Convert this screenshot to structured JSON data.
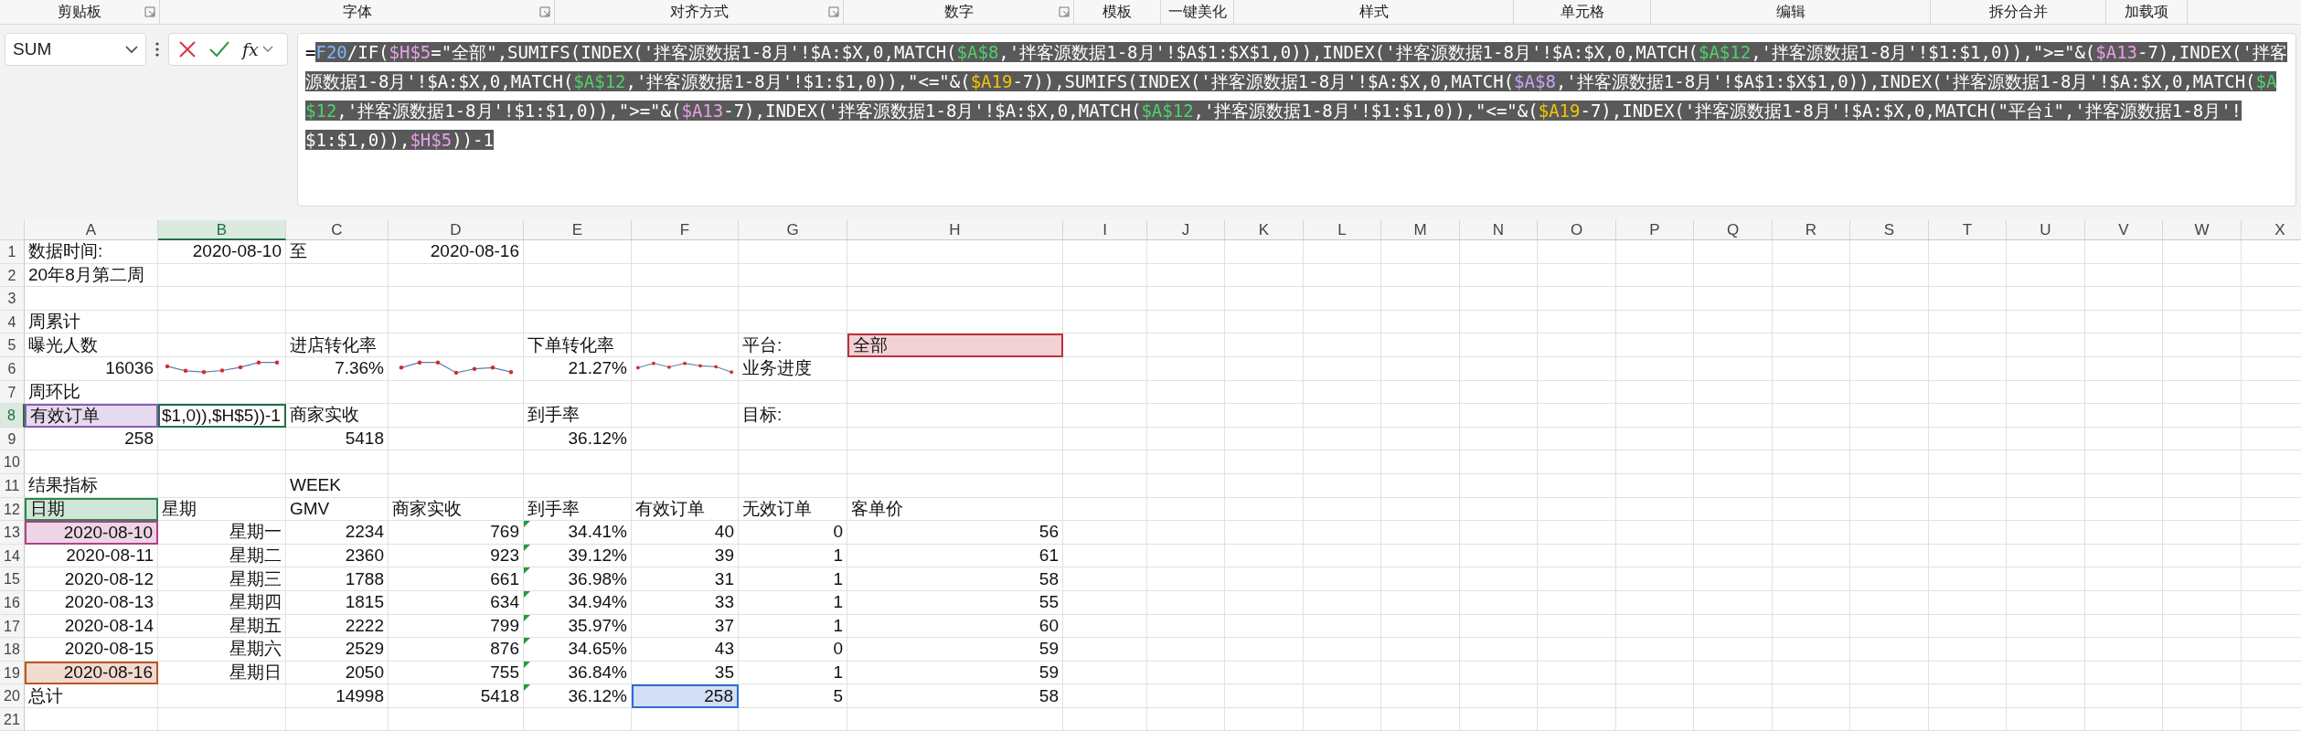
{
  "ribbon": {
    "groups": [
      {
        "label": "剪贴板",
        "launcher": true
      },
      {
        "label": "字体",
        "launcher": true
      },
      {
        "label": "对齐方式",
        "launcher": true
      },
      {
        "label": "数字",
        "launcher": true
      },
      {
        "label": "模板",
        "launcher": false
      },
      {
        "label": "一键美化",
        "launcher": false
      },
      {
        "label": "样式",
        "launcher": false
      },
      {
        "label": "单元格",
        "launcher": false
      },
      {
        "label": "编辑",
        "launcher": false
      },
      {
        "label": "拆分合并",
        "launcher": false
      },
      {
        "label": "加载项",
        "launcher": false
      }
    ]
  },
  "formula_bar": {
    "name_box": "SUM",
    "fx_label": "fx",
    "formula": [
      {
        "text": "=",
        "kind": "text",
        "selected": false
      },
      {
        "text": "F20",
        "kind": "reference",
        "selected": true
      },
      {
        "text": "/IF(",
        "kind": "text",
        "selected": true
      },
      {
        "text": "$H$5",
        "kind": "reference",
        "selected": true
      },
      {
        "text": "=\"全部\",SUMIFS(INDEX('拌客源数据1-8月'!$A:$X,0,MATCH(",
        "kind": "text",
        "selected": true
      },
      {
        "text": "$A$8",
        "kind": "reference",
        "selected": true
      },
      {
        "text": ",'拌客源数据1-8月'!$A$1:$X$1,0)),INDEX('拌客源数据1-8月'!$A:$X,0,MATCH(",
        "kind": "text",
        "selected": true
      },
      {
        "text": "$A$12",
        "kind": "reference",
        "selected": true
      },
      {
        "text": ",'拌客源数据1-8月'!$1:$1,0)),\">=\"&(",
        "kind": "text",
        "selected": true
      },
      {
        "text": "$A13",
        "kind": "reference",
        "selected": true
      },
      {
        "text": "-7),INDEX('拌客源数据1-8月'!$A:$X,0,MATCH(",
        "kind": "text",
        "selected": true
      },
      {
        "text": "$A$12",
        "kind": "reference",
        "selected": true
      },
      {
        "text": ",'拌客源数据1-8月'!$1:$1,0)),\"<=\"&(",
        "kind": "text",
        "selected": true
      },
      {
        "text": "$A19",
        "kind": "reference",
        "selected": true
      },
      {
        "text": "-7)),SUMIFS(INDEX('拌客源数据1-8月'!$A:$X,0,MATCH(",
        "kind": "text",
        "selected": true
      },
      {
        "text": "$A$8",
        "kind": "reference",
        "selected": true
      },
      {
        "text": ",'拌客源数据1-8月'!$A$1:$X$1,0)),INDEX('拌客源数据1-8月'!$A:$X,0,MATCH(",
        "kind": "text",
        "selected": true
      },
      {
        "text": "$A$12",
        "kind": "reference",
        "selected": true
      },
      {
        "text": ",'拌客源数据1-8月'!$1:$1,0)),\">=\"&(",
        "kind": "text",
        "selected": true
      },
      {
        "text": "$A13",
        "kind": "reference",
        "selected": true
      },
      {
        "text": "-7),INDEX('拌客源数据1-8月'!$A:$X,0,MATCH(",
        "kind": "text",
        "selected": true
      },
      {
        "text": "$A$12",
        "kind": "reference",
        "selected": true
      },
      {
        "text": ",'拌客源数据1-8月'!$1:$1,0)),\"<=\"&(",
        "kind": "text",
        "selected": true
      },
      {
        "text": "$A19",
        "kind": "reference",
        "selected": true
      },
      {
        "text": "-7),INDEX('拌客源数据1-8月'!$A:$X,0,MATCH(\"平台i\",'拌客源数据1-8月'!$1:$1,0)),",
        "kind": "text",
        "selected": true
      },
      {
        "text": "$H$5",
        "kind": "reference",
        "selected": true
      },
      {
        "text": "))-1",
        "kind": "text",
        "selected": true
      }
    ]
  },
  "columns": [
    {
      "label": "A",
      "selected": false
    },
    {
      "label": "B",
      "selected": true
    },
    {
      "label": "C",
      "selected": false
    },
    {
      "label": "D",
      "selected": false
    },
    {
      "label": "E",
      "selected": false
    },
    {
      "label": "F",
      "selected": false
    },
    {
      "label": "G",
      "selected": false
    },
    {
      "label": "H",
      "selected": false
    },
    {
      "label": "I",
      "selected": false
    },
    {
      "label": "J",
      "selected": false
    },
    {
      "label": "K",
      "selected": false
    },
    {
      "label": "L",
      "selected": false
    },
    {
      "label": "M",
      "selected": false
    },
    {
      "label": "N",
      "selected": false
    },
    {
      "label": "O",
      "selected": false
    },
    {
      "label": "P",
      "selected": false
    },
    {
      "label": "Q",
      "selected": false
    },
    {
      "label": "R",
      "selected": false
    },
    {
      "label": "S",
      "selected": false
    },
    {
      "label": "T",
      "selected": false
    },
    {
      "label": "U",
      "selected": false
    },
    {
      "label": "V",
      "selected": false
    },
    {
      "label": "W",
      "selected": false
    },
    {
      "label": "X",
      "selected": false
    }
  ],
  "rows": [
    {
      "number": "1",
      "selected": false,
      "cells": {
        "A": {
          "kind": "text",
          "text": "数据时间:"
        },
        "B": {
          "kind": "number",
          "text": "2020-08-10"
        },
        "C": {
          "kind": "text",
          "text": "至"
        },
        "D": {
          "kind": "number",
          "text": "2020-08-16"
        }
      }
    },
    {
      "number": "2",
      "selected": false,
      "cells": {
        "A": {
          "kind": "text",
          "text": "20年8月第二周"
        }
      }
    },
    {
      "number": "3",
      "selected": false
    },
    {
      "number": "4",
      "selected": false,
      "cells": {
        "A": {
          "kind": "text",
          "text": "周累计"
        }
      }
    },
    {
      "number": "5",
      "selected": false,
      "cells": {
        "A": {
          "kind": "text",
          "text": "曝光人数"
        },
        "C": {
          "kind": "text",
          "text": "进店转化率"
        },
        "E": {
          "kind": "text",
          "text": "下单转化率"
        },
        "G": {
          "kind": "text",
          "text": "平台:"
        },
        "H": {
          "kind": "text",
          "text": "全部",
          "color": "#c0303c"
        }
      }
    },
    {
      "number": "6",
      "selected": false,
      "cells": {
        "A": {
          "kind": "number",
          "text": "16036"
        },
        "B": {
          "kind": "sparkline"
        },
        "C": {
          "kind": "number",
          "text": "7.36%"
        },
        "D": {
          "kind": "sparkline"
        },
        "E": {
          "kind": "number",
          "text": "21.27%"
        },
        "F": {
          "kind": "sparkline"
        },
        "G": {
          "kind": "text",
          "text": "业务进度"
        }
      }
    },
    {
      "number": "7",
      "selected": false,
      "cells": {
        "A": {
          "kind": "text",
          "text": "周环比"
        }
      }
    },
    {
      "number": "8",
      "selected": true,
      "cells": {
        "A": {
          "kind": "text",
          "text": "有效订单",
          "color": "#8a5cb8"
        },
        "B": {
          "kind": "editing",
          "text": "$1,0)),$H$5))-1"
        },
        "C": {
          "kind": "text",
          "text": "商家实收"
        },
        "E": {
          "kind": "text",
          "text": "到手率"
        },
        "G": {
          "kind": "text",
          "text": "目标:"
        }
      }
    },
    {
      "number": "9",
      "selected": false,
      "cells": {
        "A": {
          "kind": "number",
          "text": "258"
        },
        "C": {
          "kind": "number",
          "text": "5418"
        },
        "E": {
          "kind": "number",
          "text": "36.12%"
        }
      }
    },
    {
      "number": "10",
      "selected": false
    },
    {
      "number": "11",
      "selected": false,
      "cells": {
        "A": {
          "kind": "text",
          "text": "结果指标"
        },
        "C": {
          "kind": "text",
          "text": "WEEK"
        }
      }
    },
    {
      "number": "12",
      "selected": false,
      "cells": {
        "A": {
          "kind": "text",
          "text": "日期",
          "color": "#2a8a4a"
        },
        "B": {
          "kind": "text",
          "text": "星期"
        },
        "C": {
          "kind": "text",
          "text": "GMV"
        },
        "D": {
          "kind": "text",
          "text": "商家实收"
        },
        "E": {
          "kind": "text",
          "text": "到手率"
        },
        "F": {
          "kind": "text",
          "text": "有效订单"
        },
        "G": {
          "kind": "text",
          "text": "无效订单"
        },
        "H": {
          "kind": "text",
          "text": "客单价"
        }
      }
    },
    {
      "number": "13",
      "selected": false,
      "cells": {
        "A": {
          "kind": "number",
          "text": "2020-08-10",
          "color": "#b0408a"
        },
        "B": {
          "kind": "number",
          "text": "星期一"
        },
        "C": {
          "kind": "number",
          "text": "2234"
        },
        "D": {
          "kind": "number",
          "text": "769"
        },
        "E": {
          "kind": "number",
          "text": "34.41%",
          "mark": true
        },
        "F": {
          "kind": "number",
          "text": "40"
        },
        "G": {
          "kind": "number",
          "text": "0"
        },
        "H": {
          "kind": "number",
          "text": "56"
        }
      }
    },
    {
      "number": "14",
      "selected": false,
      "cells": {
        "A": {
          "kind": "number",
          "text": "2020-08-11"
        },
        "B": {
          "kind": "number",
          "text": "星期二"
        },
        "C": {
          "kind": "number",
          "text": "2360"
        },
        "D": {
          "kind": "number",
          "text": "923"
        },
        "E": {
          "kind": "number",
          "text": "39.12%",
          "mark": true
        },
        "F": {
          "kind": "number",
          "text": "39"
        },
        "G": {
          "kind": "number",
          "text": "1"
        },
        "H": {
          "kind": "number",
          "text": "61"
        }
      }
    },
    {
      "number": "15",
      "selected": false,
      "cells": {
        "A": {
          "kind": "number",
          "text": "2020-08-12"
        },
        "B": {
          "kind": "number",
          "text": "星期三"
        },
        "C": {
          "kind": "number",
          "text": "1788"
        },
        "D": {
          "kind": "number",
          "text": "661"
        },
        "E": {
          "kind": "number",
          "text": "36.98%",
          "mark": true
        },
        "F": {
          "kind": "number",
          "text": "31"
        },
        "G": {
          "kind": "number",
          "text": "1"
        },
        "H": {
          "kind": "number",
          "text": "58"
        }
      }
    },
    {
      "number": "16",
      "selected": false,
      "cells": {
        "A": {
          "kind": "number",
          "text": "2020-08-13"
        },
        "B": {
          "kind": "number",
          "text": "星期四"
        },
        "C": {
          "kind": "number",
          "text": "1815"
        },
        "D": {
          "kind": "number",
          "text": "634"
        },
        "E": {
          "kind": "number",
          "text": "34.94%",
          "mark": true
        },
        "F": {
          "kind": "number",
          "text": "33"
        },
        "G": {
          "kind": "number",
          "text": "1"
        },
        "H": {
          "kind": "number",
          "text": "55"
        }
      }
    },
    {
      "number": "17",
      "selected": false,
      "cells": {
        "A": {
          "kind": "number",
          "text": "2020-08-14"
        },
        "B": {
          "kind": "number",
          "text": "星期五"
        },
        "C": {
          "kind": "number",
          "text": "2222"
        },
        "D": {
          "kind": "number",
          "text": "799"
        },
        "E": {
          "kind": "number",
          "text": "35.97%",
          "mark": true
        },
        "F": {
          "kind": "number",
          "text": "37"
        },
        "G": {
          "kind": "number",
          "text": "1"
        },
        "H": {
          "kind": "number",
          "text": "60"
        }
      }
    },
    {
      "number": "18",
      "selected": false,
      "cells": {
        "A": {
          "kind": "number",
          "text": "2020-08-15"
        },
        "B": {
          "kind": "number",
          "text": "星期六"
        },
        "C": {
          "kind": "number",
          "text": "2529"
        },
        "D": {
          "kind": "number",
          "text": "876"
        },
        "E": {
          "kind": "number",
          "text": "34.65%",
          "mark": true
        },
        "F": {
          "kind": "number",
          "text": "43"
        },
        "G": {
          "kind": "number",
          "text": "0"
        },
        "H": {
          "kind": "number",
          "text": "59"
        }
      }
    },
    {
      "number": "19",
      "selected": false,
      "cells": {
        "A": {
          "kind": "number",
          "text": "2020-08-16",
          "color": "#c0561f"
        },
        "B": {
          "kind": "number",
          "text": "星期日"
        },
        "C": {
          "kind": "number",
          "text": "2050"
        },
        "D": {
          "kind": "number",
          "text": "755"
        },
        "E": {
          "kind": "number",
          "text": "36.84%",
          "mark": true
        },
        "F": {
          "kind": "number",
          "text": "35"
        },
        "G": {
          "kind": "number",
          "text": "1"
        },
        "H": {
          "kind": "number",
          "text": "59"
        }
      }
    },
    {
      "number": "20",
      "selected": false,
      "cells": {
        "A": {
          "kind": "text",
          "text": "总计"
        },
        "C": {
          "kind": "number",
          "text": "14998"
        },
        "D": {
          "kind": "number",
          "text": "5418"
        },
        "E": {
          "kind": "number",
          "text": "36.12%",
          "mark": true
        },
        "F": {
          "kind": "number",
          "text": "258",
          "color": "#2e6bd6"
        },
        "G": {
          "kind": "number",
          "text": "5"
        },
        "H": {
          "kind": "number",
          "text": "58"
        }
      }
    },
    {
      "number": "21",
      "selected": false
    }
  ]
}
